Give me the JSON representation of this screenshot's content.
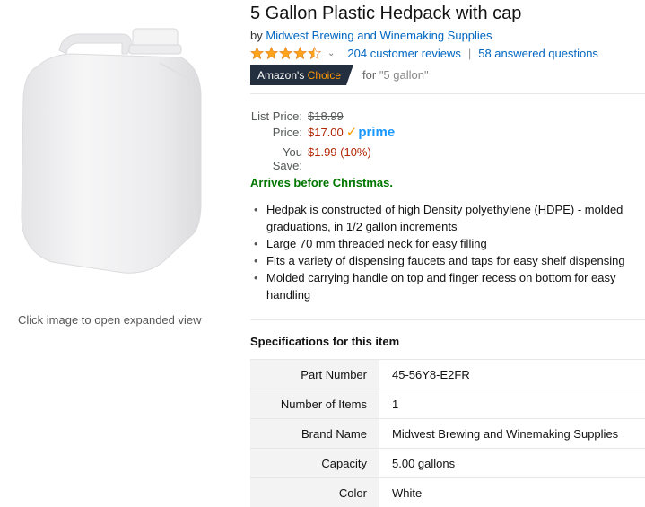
{
  "product": {
    "title": "5 Gallon Plastic Hedpack with cap",
    "by_prefix": "by",
    "brand": "Midwest Brewing and Winemaking Supplies",
    "rating_stars": 4.5,
    "reviews": "204 customer reviews",
    "separator": "|",
    "questions": "58 answered questions",
    "choice_badge_1": "Amazon's",
    "choice_badge_2": "Choice",
    "choice_for": "for",
    "choice_query": "\"5 gallon\""
  },
  "price": {
    "list_label": "List Price:",
    "list_value": "$18.99",
    "price_label": "Price:",
    "price_value": "$17.00",
    "prime": "prime",
    "save_label": "You Save:",
    "save_value": "$1.99 (10%)"
  },
  "arrives": "Arrives before Christmas.",
  "bullets": [
    "Hedpak is constructed of high Density polyethylene (HDPE) - molded graduations, in 1/2 gallon increments",
    "Large 70 mm threaded neck for easy filling",
    "Fits a variety of dispensing faucets and taps for easy shelf dispensing",
    "Molded carrying handle on top and finger recess on bottom for easy handling"
  ],
  "image_hint": "Click image to open expanded view",
  "specs": {
    "title": "Specifications for this item",
    "rows": [
      {
        "key": "Part Number",
        "value": "45-56Y8-E2FR"
      },
      {
        "key": "Number of Items",
        "value": "1"
      },
      {
        "key": "Brand Name",
        "value": "Midwest Brewing and Winemaking Supplies"
      },
      {
        "key": "Capacity",
        "value": "5.00  gallons"
      },
      {
        "key": "Color",
        "value": "White"
      }
    ]
  },
  "colors": {
    "link": "#0066c0",
    "price_red": "#b12704",
    "star": "#ffa41c",
    "badge_bg": "#232f3e",
    "badge_accent": "#ff9900",
    "arrives_green": "#007600"
  },
  "icons": [
    "star-icon",
    "chevron-down-icon",
    "prime-check-icon"
  ]
}
